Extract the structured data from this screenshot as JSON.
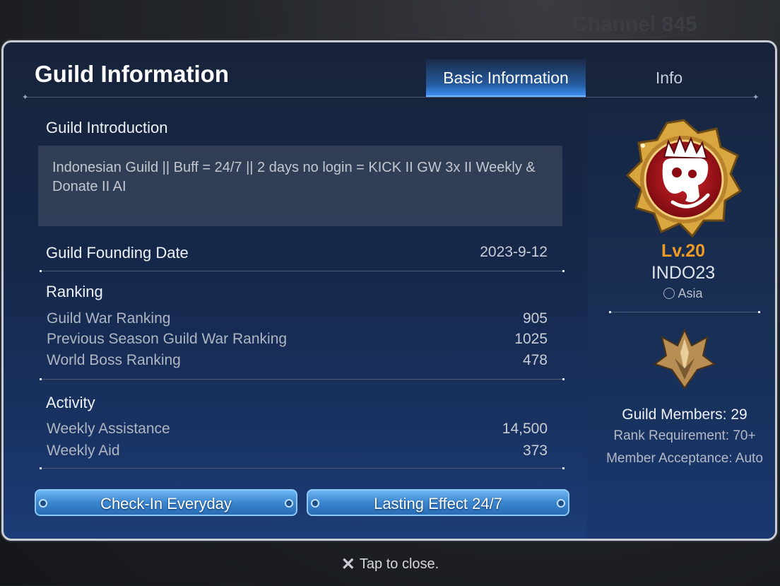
{
  "backdrop": {
    "channel_label": "Channel 845"
  },
  "panel": {
    "title": "Guild Information",
    "tabs": [
      {
        "label": "Basic Information",
        "active": true
      },
      {
        "label": "Info",
        "active": false
      }
    ]
  },
  "introduction": {
    "heading": "Guild Introduction",
    "text": "Indonesian Guild || Buff = 24/7 || 2 days no login = KICK II GW 3x II Weekly & Donate II AI"
  },
  "founding": {
    "label": "Guild Founding Date",
    "value": "2023-9-12"
  },
  "ranking": {
    "heading": "Ranking",
    "rows": [
      {
        "label": "Guild War Ranking",
        "value": "905"
      },
      {
        "label": "Previous Season Guild War Ranking",
        "value": "1025"
      },
      {
        "label": "World Boss Ranking",
        "value": "478"
      }
    ]
  },
  "activity": {
    "heading": "Activity",
    "rows": [
      {
        "label": "Weekly Assistance",
        "value": "14,500"
      },
      {
        "label": "Weekly Aid",
        "value": "373"
      }
    ]
  },
  "buttons": [
    {
      "label": "Check-In Everyday"
    },
    {
      "label": "Lasting Effect 24/7"
    }
  ],
  "guild": {
    "level": "Lv.20",
    "name": "INDO23",
    "region": "Asia",
    "members": "Guild Members: 29",
    "rank_requirement": "Rank Requirement: 70+",
    "member_acceptance": "Member Acceptance: Auto"
  },
  "footer": {
    "close_text": "Tap to close."
  },
  "icons": {
    "emblem": "crowned-skull-emblem-icon",
    "rank": "guild-rank-crest-icon",
    "region": "globe-icon",
    "close": "close-icon"
  },
  "colors": {
    "level": "#f09a23",
    "active_tab": "#3a8ff0",
    "button": "#3b86d0",
    "emblem_red": "#b0141c",
    "emblem_gold": "#d9a640"
  }
}
